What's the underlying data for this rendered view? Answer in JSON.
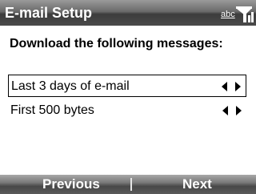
{
  "title_bar": {
    "title": "E-mail Setup",
    "input_mode": "abc",
    "signal_icon": "signal-strength-icon"
  },
  "heading": "Download the following messages:",
  "settings": [
    {
      "value": "Last 3 days of e-mail",
      "selected": true
    },
    {
      "value": "First 500 bytes",
      "selected": false
    }
  ],
  "softkeys": {
    "left": "Previous",
    "right": "Next"
  },
  "colors": {
    "bar_dark": "#3c3c3c",
    "bar_light": "#9a9a9a",
    "text": "#000000",
    "bar_text": "#ffffff"
  }
}
